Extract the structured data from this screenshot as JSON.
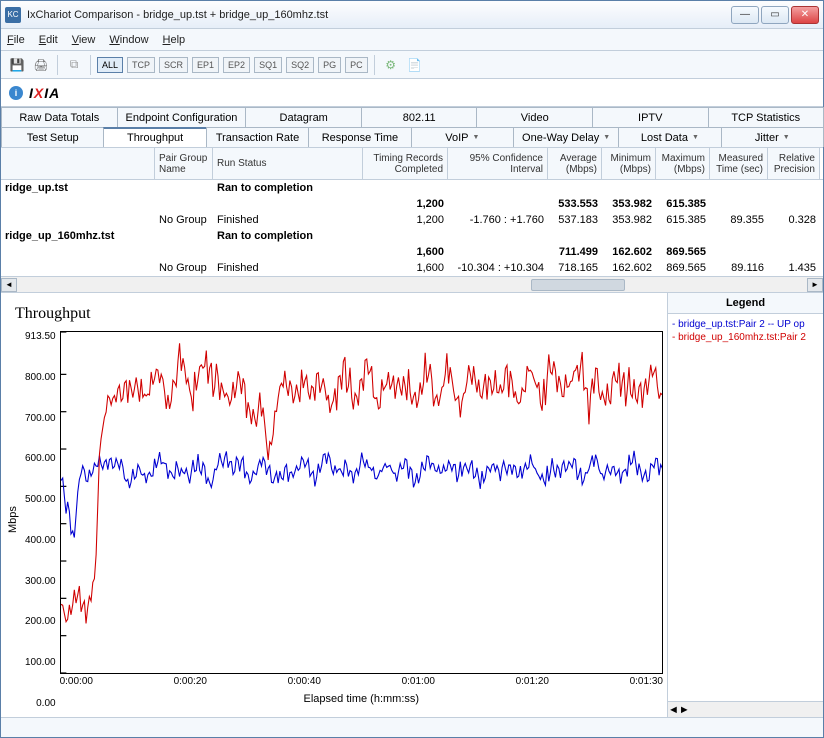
{
  "title": "IxChariot Comparison - bridge_up.tst + bridge_up_160mhz.tst",
  "menu": {
    "file": "File",
    "edit": "Edit",
    "view": "View",
    "window": "Window",
    "help": "Help"
  },
  "filters": {
    "all": "ALL",
    "tcp": "TCP",
    "scr": "SCR",
    "ep1": "EP1",
    "ep2": "EP2",
    "sq1": "SQ1",
    "sq2": "SQ2",
    "pg": "PG",
    "pc": "PC"
  },
  "logo": "IXIA",
  "tabs_row1": [
    "Raw Data Totals",
    "Endpoint Configuration",
    "Datagram",
    "802.11",
    "Video",
    "IPTV",
    "TCP Statistics"
  ],
  "tabs_row2": [
    "Test Setup",
    "Throughput",
    "Transaction Rate",
    "Response Time",
    "VoIP",
    "One-Way Delay",
    "Lost Data",
    "Jitter"
  ],
  "active_tab": "Throughput",
  "grid_headers": {
    "c0": "",
    "c1": "Pair Group Name",
    "c2": "Run Status",
    "c3": "Timing Records Completed",
    "c4": "95% Confidence Interval",
    "c5": "Average (Mbps)",
    "c6": "Minimum (Mbps)",
    "c7": "Maximum (Mbps)",
    "c8": "Measured Time (sec)",
    "c9": "Relative Precision"
  },
  "rows": [
    {
      "file": "ridge_up.tst",
      "status_bold": "Ran to completion",
      "summary": {
        "timing": "1,200",
        "avg": "533.553",
        "min": "353.982",
        "max": "615.385"
      },
      "detail": {
        "group": "No Group",
        "status": "Finished",
        "timing": "1,200",
        "ci": "-1.760 : +1.760",
        "avg": "537.183",
        "min": "353.982",
        "max": "615.385",
        "time": "89.355",
        "prec": "0.328"
      }
    },
    {
      "file": "ridge_up_160mhz.tst",
      "status_bold": "Ran to completion",
      "summary": {
        "timing": "1,600",
        "avg": "711.499",
        "min": "162.602",
        "max": "869.565"
      },
      "detail": {
        "group": "No Group",
        "status": "Finished",
        "timing": "1,600",
        "ci": "-10.304 : +10.304",
        "avg": "718.165",
        "min": "162.602",
        "max": "869.565",
        "time": "89.116",
        "prec": "1.435"
      }
    }
  ],
  "chart": {
    "title": "Throughput",
    "ylabel": "Mbps",
    "xlabel": "Elapsed time (h:mm:ss)",
    "yticks": [
      "913.50",
      "800.00",
      "700.00",
      "600.00",
      "500.00",
      "400.00",
      "300.00",
      "200.00",
      "100.00",
      "0.00"
    ],
    "xticks": [
      "0:00:00",
      "0:00:20",
      "0:00:40",
      "0:01:00",
      "0:01:20",
      "0:01:30"
    ]
  },
  "legend": {
    "title": "Legend",
    "items": [
      {
        "color": "blue",
        "text": "- bridge_up.tst:Pair 2 -- UP op"
      },
      {
        "color": "red",
        "text": "- bridge_up_160mhz.tst:Pair 2"
      }
    ]
  },
  "chart_data": {
    "type": "line",
    "title": "Throughput",
    "xlabel": "Elapsed time (h:mm:ss)",
    "ylabel": "Mbps",
    "ylim": [
      0,
      913.5
    ],
    "xlim_seconds": [
      0,
      90
    ],
    "series": [
      {
        "name": "bridge_up.tst:Pair 2 -- UP op",
        "color": "#0000d0",
        "approx_values_seconds_mbps": [
          [
            0,
            530
          ],
          [
            2,
            360
          ],
          [
            3,
            555
          ],
          [
            5,
            530
          ],
          [
            7,
            570
          ],
          [
            10,
            540
          ],
          [
            12,
            520
          ],
          [
            15,
            560
          ],
          [
            18,
            530
          ],
          [
            20,
            555
          ],
          [
            22,
            520
          ],
          [
            25,
            575
          ],
          [
            28,
            535
          ],
          [
            30,
            560
          ],
          [
            33,
            525
          ],
          [
            35,
            555
          ],
          [
            38,
            540
          ],
          [
            40,
            565
          ],
          [
            43,
            530
          ],
          [
            45,
            560
          ],
          [
            48,
            535
          ],
          [
            50,
            555
          ],
          [
            53,
            525
          ],
          [
            55,
            560
          ],
          [
            58,
            540
          ],
          [
            60,
            555
          ],
          [
            63,
            528
          ],
          [
            65,
            560
          ],
          [
            68,
            535
          ],
          [
            70,
            555
          ],
          [
            73,
            525
          ],
          [
            75,
            560
          ],
          [
            78,
            540
          ],
          [
            80,
            555
          ],
          [
            83,
            530
          ],
          [
            85,
            558
          ],
          [
            88,
            535
          ],
          [
            90,
            548
          ]
        ]
      },
      {
        "name": "bridge_up_160mhz.tst:Pair 2",
        "color": "#d00000",
        "approx_values_seconds_mbps": [
          [
            0,
            170
          ],
          [
            2,
            175
          ],
          [
            3,
            200
          ],
          [
            4,
            210
          ],
          [
            5,
            240
          ],
          [
            6,
            640
          ],
          [
            7,
            750
          ],
          [
            8,
            710
          ],
          [
            10,
            780
          ],
          [
            12,
            730
          ],
          [
            14,
            800
          ],
          [
            16,
            740
          ],
          [
            18,
            820
          ],
          [
            20,
            760
          ],
          [
            22,
            840
          ],
          [
            24,
            730
          ],
          [
            26,
            790
          ],
          [
            28,
            720
          ],
          [
            30,
            680
          ],
          [
            31,
            590
          ],
          [
            32,
            700
          ],
          [
            34,
            770
          ],
          [
            36,
            740
          ],
          [
            38,
            800
          ],
          [
            40,
            730
          ],
          [
            42,
            790
          ],
          [
            44,
            750
          ],
          [
            46,
            810
          ],
          [
            48,
            730
          ],
          [
            50,
            780
          ],
          [
            52,
            740
          ],
          [
            54,
            800
          ],
          [
            56,
            745
          ],
          [
            58,
            790
          ],
          [
            60,
            730
          ],
          [
            62,
            785
          ],
          [
            64,
            740
          ],
          [
            66,
            800
          ],
          [
            68,
            735
          ],
          [
            70,
            790
          ],
          [
            72,
            750
          ],
          [
            74,
            820
          ],
          [
            76,
            740
          ],
          [
            78,
            860
          ],
          [
            79,
            700
          ],
          [
            80,
            790
          ],
          [
            82,
            740
          ],
          [
            84,
            800
          ],
          [
            86,
            740
          ],
          [
            88,
            790
          ],
          [
            90,
            745
          ]
        ]
      }
    ]
  }
}
